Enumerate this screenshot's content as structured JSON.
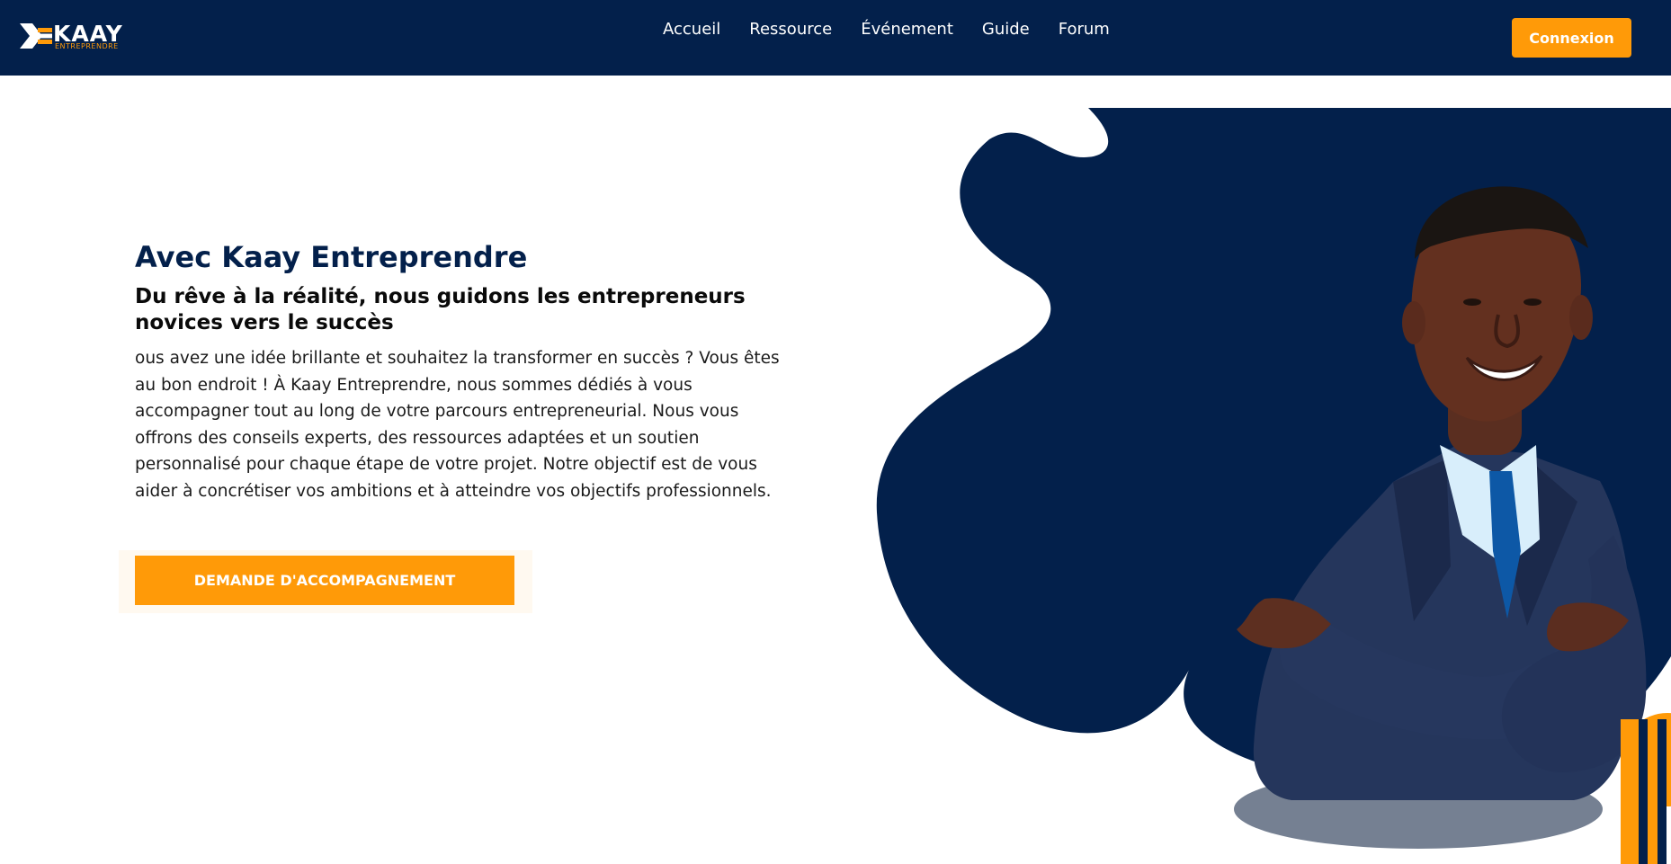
{
  "header": {
    "logo": {
      "name": "KAAY",
      "tagline": "ENTREPRENDRE"
    },
    "nav": [
      {
        "label": "Accueil"
      },
      {
        "label": "Ressource"
      },
      {
        "label": "Événement"
      },
      {
        "label": "Guide"
      },
      {
        "label": "Forum"
      }
    ],
    "login_label": "Connexion"
  },
  "hero": {
    "title": "Avec Kaay Entreprendre",
    "subtitle": "Du rêve à la réalité, nous guidons les entrepreneurs novices vers le succès",
    "paragraph": "ous avez une idée brillante et souhaitez la transformer en succès ? Vous êtes au bon endroit ! À Kaay Entreprendre, nous sommes dédiés à vous accompagner tout au long de votre parcours entrepreneurial. Nous vous offrons des conseils experts, des ressources adaptées et un soutien personnalisé pour chaque étape de votre projet. Notre objectif est de vous aider à concrétiser vos ambitions et à atteindre vos objectifs professionnels.",
    "cta_label": "DEMANDE D'ACCOMPAGNEMENT"
  },
  "illustration": {
    "subject": "smiling businessman in navy suit with arms crossed",
    "shape": "navy blob background",
    "accent_shape": "orange circle with navy stripes"
  },
  "colors": {
    "navy": "#03204b",
    "orange": "#ff9a08",
    "white": "#ffffff",
    "text": "#1a1a1a"
  }
}
